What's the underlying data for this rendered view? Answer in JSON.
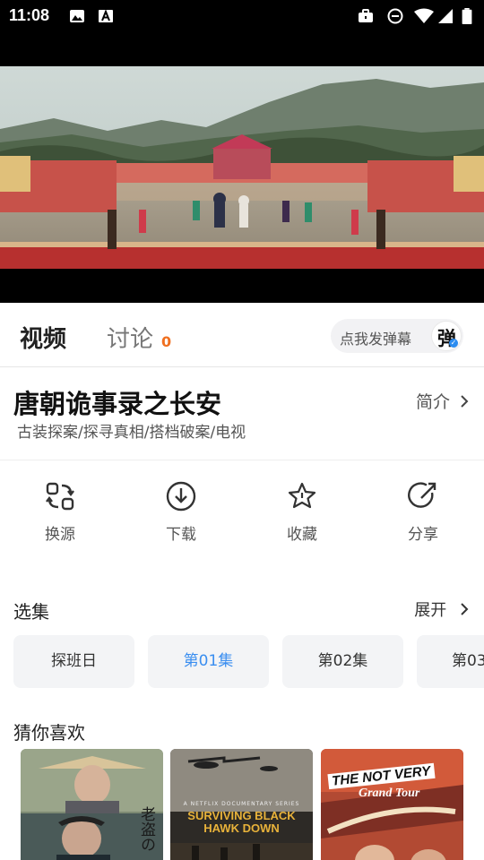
{
  "status_bar": {
    "time": "11:08",
    "icons": [
      "image-icon",
      "text-a-icon",
      "briefcase-icon",
      "do-not-disturb-icon",
      "wifi-icon",
      "signal-icon",
      "battery-icon"
    ]
  },
  "tabs": {
    "video_label": "视频",
    "discuss_label": "讨论",
    "discuss_count": "0",
    "danmu_button": "点我发弹幕",
    "danmu_icon_glyph": "弹"
  },
  "show": {
    "title": "唐朝诡事录之长安",
    "tags": "古装探案/探寻真相/搭档破案/电视",
    "intro_link": "简介"
  },
  "actions": [
    {
      "label": "换源",
      "icon": "switch-source-icon"
    },
    {
      "label": "下载",
      "icon": "download-icon"
    },
    {
      "label": "收藏",
      "icon": "star-icon"
    },
    {
      "label": "分享",
      "icon": "share-icon"
    }
  ],
  "episodes_section": {
    "title": "选集",
    "expand_label": "展开",
    "episodes": [
      "探班日",
      "第01集",
      "第02集",
      "第03"
    ],
    "active_index": 1
  },
  "recommend_section": {
    "title": "猜你喜欢",
    "cards": [
      {
        "poster_text": "老盗の"
      },
      {
        "poster_text": "SURVIVING BLACK HAWK DOWN",
        "poster_subtext": "A NETFLIX DOCUMENTARY SERIES"
      },
      {
        "poster_text": "THE NOT VERY",
        "poster_subtext": "Grand Tour"
      }
    ]
  },
  "colors": {
    "accent_blue": "#3a8ef0",
    "badge_orange": "#f07020"
  }
}
